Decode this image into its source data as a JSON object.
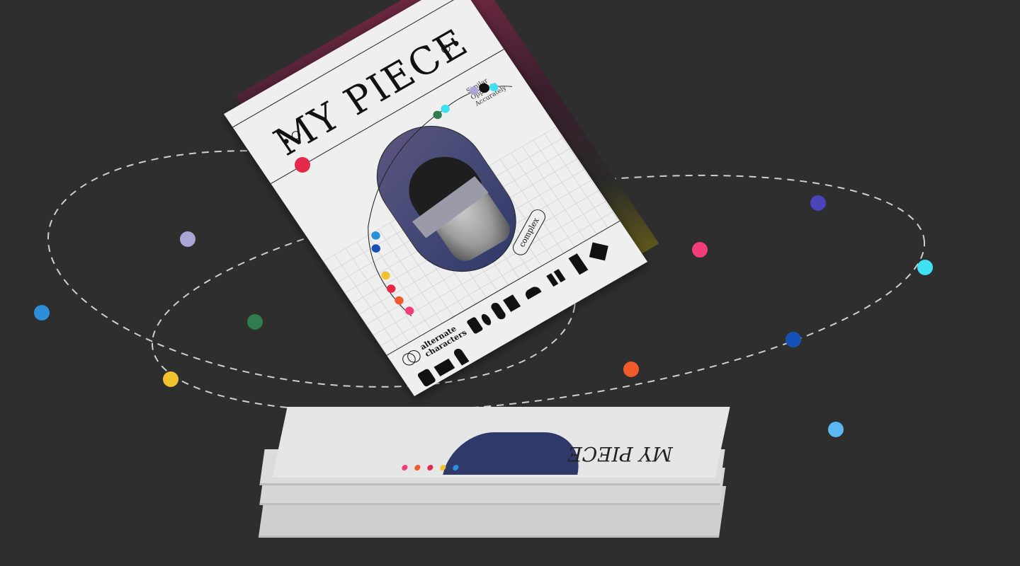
{
  "cover": {
    "title": "MY PIECE",
    "side_lines": [
      "Similar",
      "Opposite",
      "Accurately"
    ],
    "badge": "complex",
    "alt_label_line1": "alternate",
    "alt_label_line2": "characters"
  },
  "orbit_dots": [
    {
      "name": "orbit-dot-red",
      "color": "#e5294a"
    },
    {
      "name": "orbit-dot-lavender",
      "color": "#a9a5d6"
    },
    {
      "name": "orbit-dot-blue",
      "color": "#2b8fd9"
    },
    {
      "name": "orbit-dot-green",
      "color": "#2f7d4f"
    },
    {
      "name": "orbit-dot-yellow",
      "color": "#f2c12e"
    },
    {
      "name": "orbit-dot-indigo",
      "color": "#4b44b8"
    },
    {
      "name": "orbit-dot-cyan",
      "color": "#3ee0f2"
    },
    {
      "name": "orbit-dot-pink",
      "color": "#f23d7a"
    },
    {
      "name": "orbit-dot-navy",
      "color": "#1552b8"
    },
    {
      "name": "orbit-dot-orange",
      "color": "#f25a2a"
    },
    {
      "name": "orbit-dot-skyblue",
      "color": "#5ab8f2"
    }
  ],
  "colors": {
    "background": "#2e2e2e",
    "orbit_line": "#cfcfcf",
    "cover": "#efefef"
  }
}
